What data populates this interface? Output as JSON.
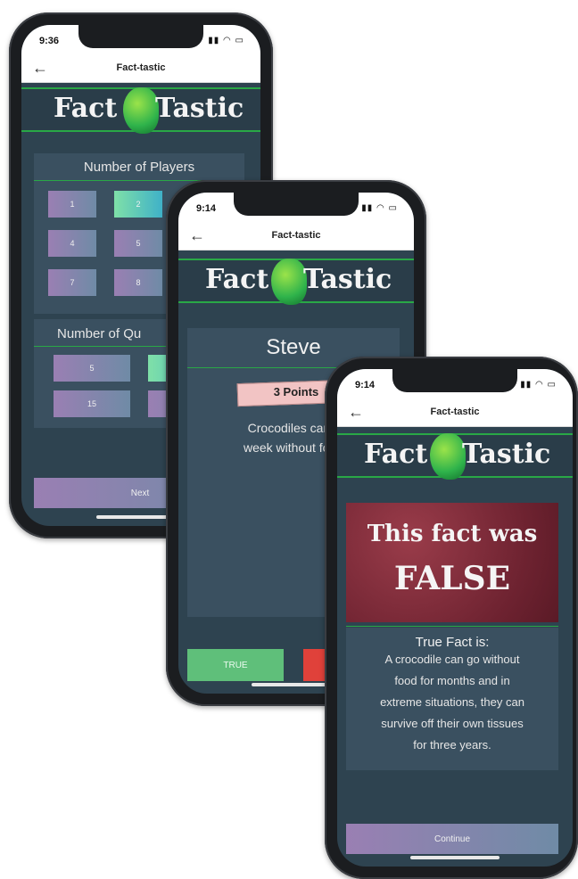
{
  "app": {
    "nav_title": "Fact-tastic",
    "logo_left": "Fact",
    "logo_right": "Tastic"
  },
  "phone1": {
    "time": "9:36",
    "players_header": "Number of Players",
    "player_buttons": [
      "1",
      "2",
      "",
      "4",
      "5",
      "",
      "7",
      "8",
      ""
    ],
    "questions_header": "Number of Qu",
    "question_buttons": [
      "5",
      "",
      "15",
      ""
    ],
    "next_label": "Next"
  },
  "phone2": {
    "time": "9:14",
    "player_name": "Steve",
    "points_label": "3 Points",
    "fact_line1": "Crocodiles can li",
    "fact_line2": "week without food",
    "true_label": "TRUE"
  },
  "phone3": {
    "time": "9:14",
    "verdict_line1": "This fact was",
    "verdict_line2": "FALSE",
    "true_fact_header": "True Fact is:",
    "true_fact_lines": [
      "A crocodile can go without",
      "food for months and in",
      "extreme situations, they can",
      "survive off their own tissues",
      "for three years."
    ],
    "continue_label": "Continue"
  },
  "colors": {
    "screen_bg": "#2e4350",
    "accent_green": "#29a846",
    "false_red": "#7d2a38",
    "true_green": "#5fbf7a",
    "false_button_red": "#e0413a"
  },
  "icons": [
    "back-arrow-icon",
    "brain-head-logo-icon",
    "signal-icon",
    "wifi-icon",
    "battery-icon",
    "ribbon-banner-icon"
  ]
}
